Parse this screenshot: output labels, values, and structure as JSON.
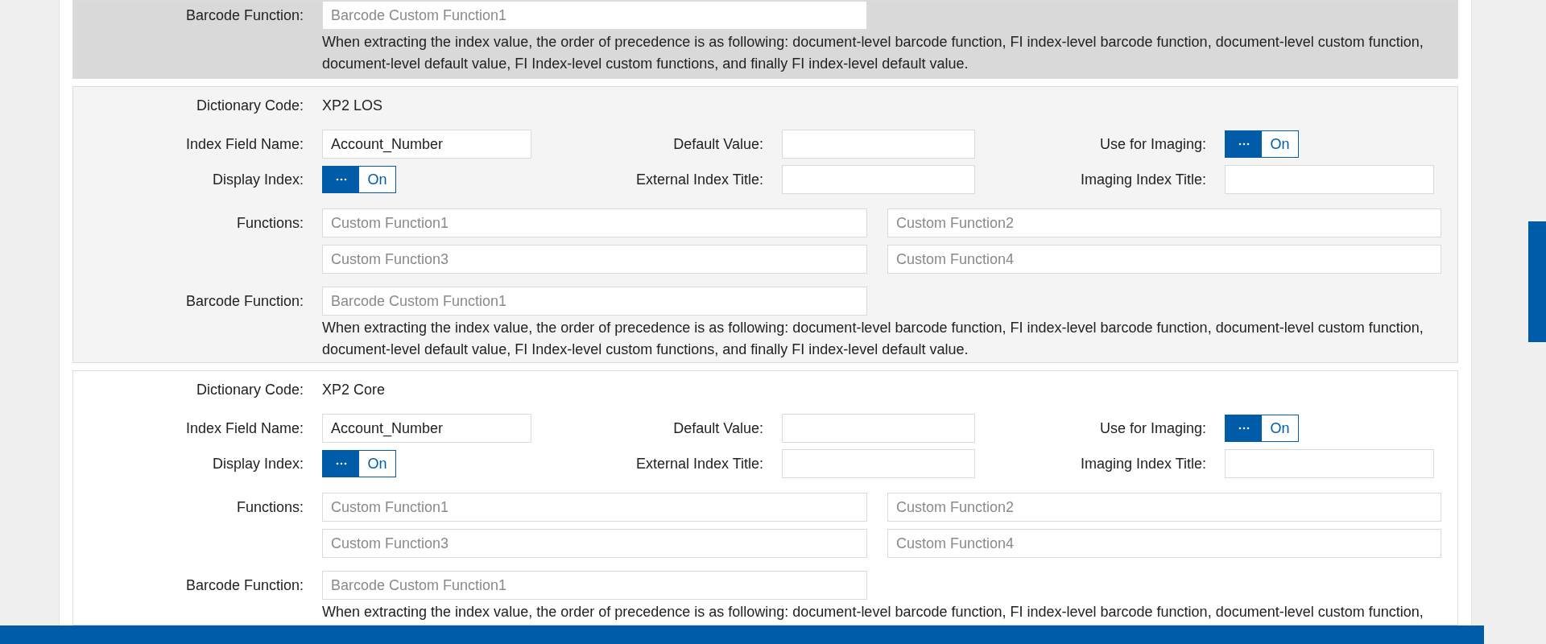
{
  "sections": [
    {
      "color": "#d9d9d9",
      "barcode_function": {
        "label": "Barcode Function:",
        "placeholder": "Barcode Custom Function1"
      },
      "note": "When extracting the index value, the order of precedence is as following: document-level barcode function, FI index-level barcode function, document-level custom function, document-level default value, FI Index-level custom functions, and finally FI index-level default value."
    },
    {
      "color": "#f4f4f4",
      "dictionary_code": {
        "label": "Dictionary Code:",
        "value": "XP2 LOS"
      },
      "index_field_name": {
        "label": "Index Field Name:",
        "value": "Account_Number"
      },
      "default_value": {
        "label": "Default Value:"
      },
      "use_for_imaging": {
        "label": "Use for Imaging:",
        "on": true,
        "text": "On"
      },
      "display_index": {
        "label": "Display Index:",
        "on": true,
        "text": "On"
      },
      "external_index_title": {
        "label": "External Index Title:"
      },
      "imaging_index_title": {
        "label": "Imaging Index Title:"
      },
      "functions": {
        "label": "Functions:",
        "placeholders": [
          "Custom Function1",
          "Custom Function2",
          "Custom Function3",
          "Custom Function4"
        ]
      },
      "barcode_function": {
        "label": "Barcode Function:",
        "placeholder": "Barcode Custom Function1"
      },
      "note": "When extracting the index value, the order of precedence is as following: document-level barcode function, FI index-level barcode function, document-level custom function, document-level default value, FI Index-level custom functions, and finally FI index-level default value."
    },
    {
      "color": "#ffffff",
      "dictionary_code": {
        "label": "Dictionary Code:",
        "value": "XP2 Core"
      },
      "index_field_name": {
        "label": "Index Field Name:",
        "value": "Account_Number"
      },
      "default_value": {
        "label": "Default Value:"
      },
      "use_for_imaging": {
        "label": "Use for Imaging:",
        "on": true,
        "text": "On"
      },
      "display_index": {
        "label": "Display Index:",
        "on": true,
        "text": "On"
      },
      "external_index_title": {
        "label": "External Index Title:"
      },
      "imaging_index_title": {
        "label": "Imaging Index Title:"
      },
      "functions": {
        "label": "Functions:",
        "placeholders": [
          "Custom Function1",
          "Custom Function2",
          "Custom Function3",
          "Custom Function4"
        ]
      },
      "barcode_function": {
        "label": "Barcode Function:",
        "placeholder": "Barcode Custom Function1"
      },
      "note": "When extracting the index value, the order of precedence is as following: document-level barcode function, FI index-level barcode function, document-level custom function,"
    }
  ]
}
